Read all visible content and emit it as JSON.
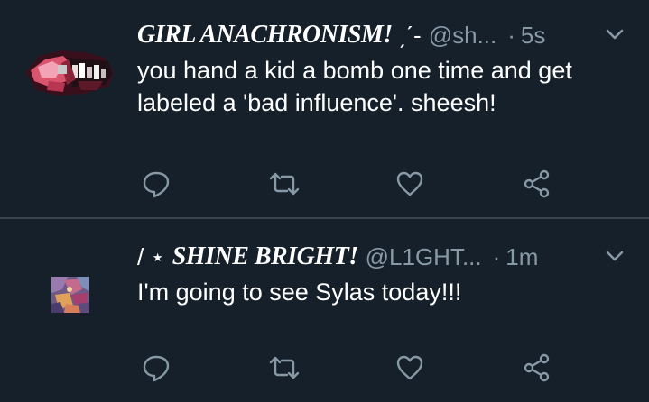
{
  "theme": {
    "background": "#15202b",
    "divider": "#38444d",
    "text_primary": "#ffffff",
    "text_secondary": "#8899a6"
  },
  "tweets": [
    {
      "display_name": "GIRL ANACHRONISM!",
      "name_decoration": "ˏˊ-",
      "handle": "@sh...",
      "separator": "·",
      "time": "5s",
      "text": "you hand a kid a bomb one time and get\nlabeled a 'bad influence'. sheesh!",
      "avatar_icon": "avatar-collage-image",
      "actions": [
        "reply-icon",
        "retweet-icon",
        "like-icon",
        "share-icon"
      ]
    },
    {
      "name_prefix": "/ ⋆",
      "display_name": "SHINE BRIGHT!",
      "handle": "@L1GHT...",
      "separator": "·",
      "time": "1m",
      "text": "I'm going to see Sylas today!!!",
      "avatar_icon": "avatar-artwork-image",
      "actions": [
        "reply-icon",
        "retweet-icon",
        "like-icon",
        "share-icon"
      ]
    }
  ]
}
